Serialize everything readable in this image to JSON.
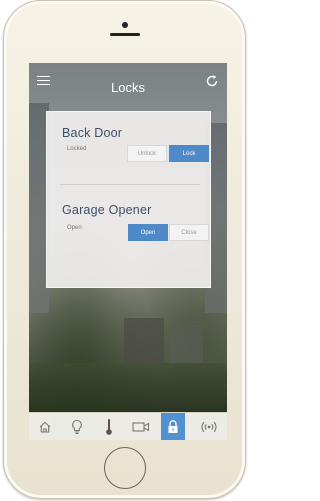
{
  "header": {
    "title": "Locks"
  },
  "locks": [
    {
      "name": "Back Door",
      "status": "Locked",
      "buttons": [
        "Unlock",
        "Lock"
      ],
      "active": 1
    },
    {
      "name": "Garage Opener",
      "status": "Open",
      "buttons": [
        "Open",
        "Close"
      ],
      "active": 0
    }
  ],
  "tabs": [
    {
      "icon": "home-icon"
    },
    {
      "icon": "lightbulb-icon"
    },
    {
      "icon": "thermometer-icon"
    },
    {
      "icon": "camera-icon"
    },
    {
      "icon": "lock-icon",
      "active": true
    },
    {
      "icon": "wireless-icon"
    }
  ],
  "colors": {
    "accent": "#4f8ac8",
    "title": "#3e4e6a"
  }
}
